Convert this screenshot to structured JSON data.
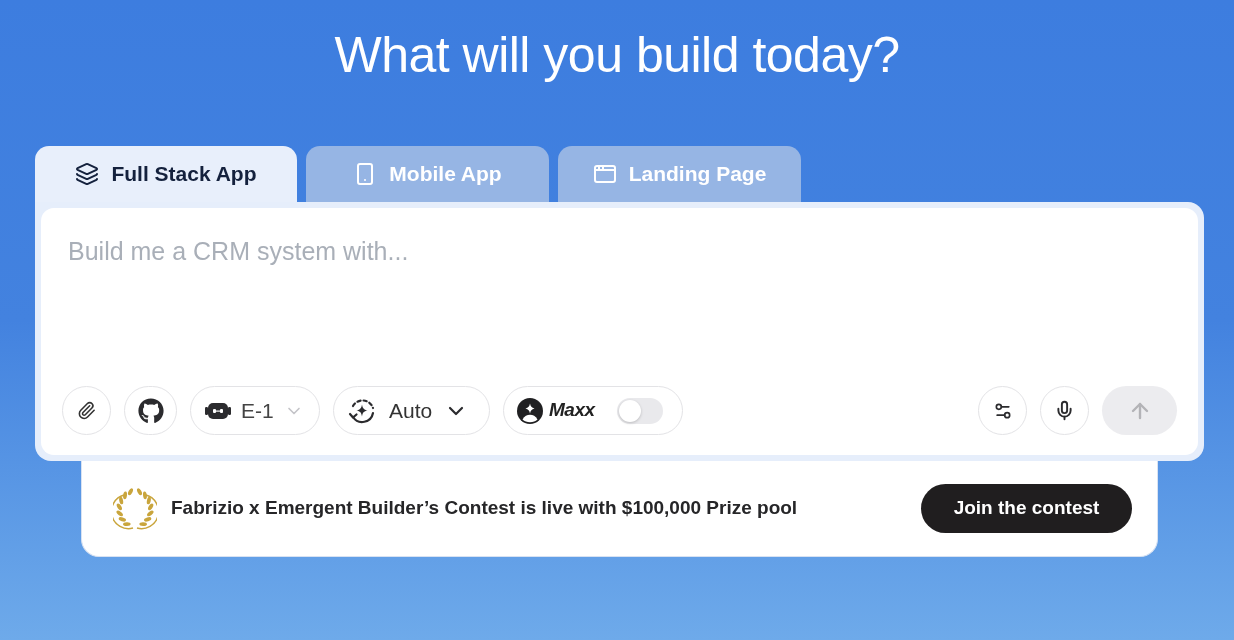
{
  "heading": "What will you build today?",
  "tabs": [
    {
      "label": "Full Stack App",
      "selected": true
    },
    {
      "label": "Mobile App",
      "selected": false
    },
    {
      "label": "Landing Page",
      "selected": false
    }
  ],
  "prompt": {
    "placeholder": "Build me a CRM system with..."
  },
  "toolbar": {
    "model": {
      "label": "E-1"
    },
    "mode": {
      "label": "Auto"
    },
    "maxx": {
      "label": "Maxx",
      "on": false
    }
  },
  "banner": {
    "text": "Fabrizio x Emergent Builder’s Contest is live with $100,000 Prize pool",
    "button": "Join the contest"
  }
}
